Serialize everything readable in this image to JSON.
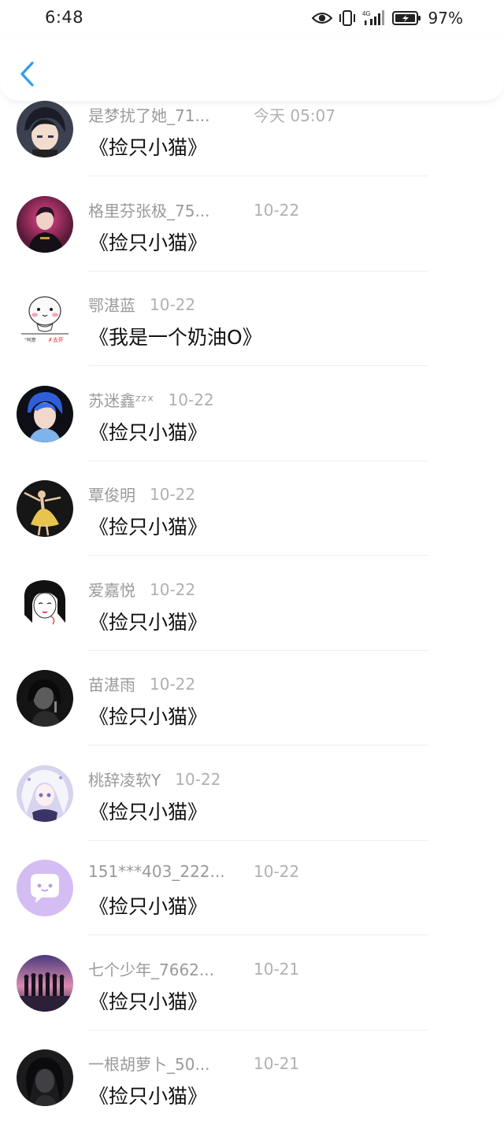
{
  "status_bar": {
    "time": "6:48",
    "battery": "97%",
    "icons": [
      "eye-icon",
      "vibrate-icon",
      "signal-4g-icon",
      "battery-charging-icon"
    ]
  },
  "header": {
    "back_icon": "chevron-left-icon",
    "accent_color": "#2d9cf0"
  },
  "messages": [
    {
      "name": "是梦扰了她_71...",
      "time": "今天 05:07",
      "text": "《捡只小猫》",
      "avatar": "anime-boy-dark"
    },
    {
      "name": "格里芬张极_75...",
      "time": "10-22",
      "text": "《捡只小猫》",
      "avatar": "boy-red-stage"
    },
    {
      "name": "鄂湛蓝",
      "time": "10-22",
      "text": "《我是一个奶油O》",
      "avatar": "cartoon-meme"
    },
    {
      "name": "苏迷鑫ᶻᶻˣ",
      "time": "10-22",
      "text": "《捡只小猫》",
      "avatar": "blue-hair-boy"
    },
    {
      "name": "覃俊明",
      "time": "10-22",
      "text": "《捡只小猫》",
      "avatar": "ballet-dancer"
    },
    {
      "name": "爱嘉悦",
      "time": "10-22",
      "text": "《捡只小猫》",
      "avatar": "sketch-girl"
    },
    {
      "name": "苗湛雨",
      "time": "10-22",
      "text": "《捡只小猫》",
      "avatar": "dark-portrait"
    },
    {
      "name": "桃辞凌软Y",
      "time": "10-22",
      "text": "《捡只小猫》",
      "avatar": "anime-girl-white"
    },
    {
      "name": "151***403_222...",
      "time": "10-22",
      "text": "《捡只小猫》",
      "avatar": "default-chat-bubble"
    },
    {
      "name": "七个少年_7662...",
      "time": "10-21",
      "text": "《捡只小猫》",
      "avatar": "group-sunset"
    },
    {
      "name": "一根胡萝卜_50...",
      "time": "10-21",
      "text": "《捡只小猫》",
      "avatar": "dark-girl"
    }
  ]
}
